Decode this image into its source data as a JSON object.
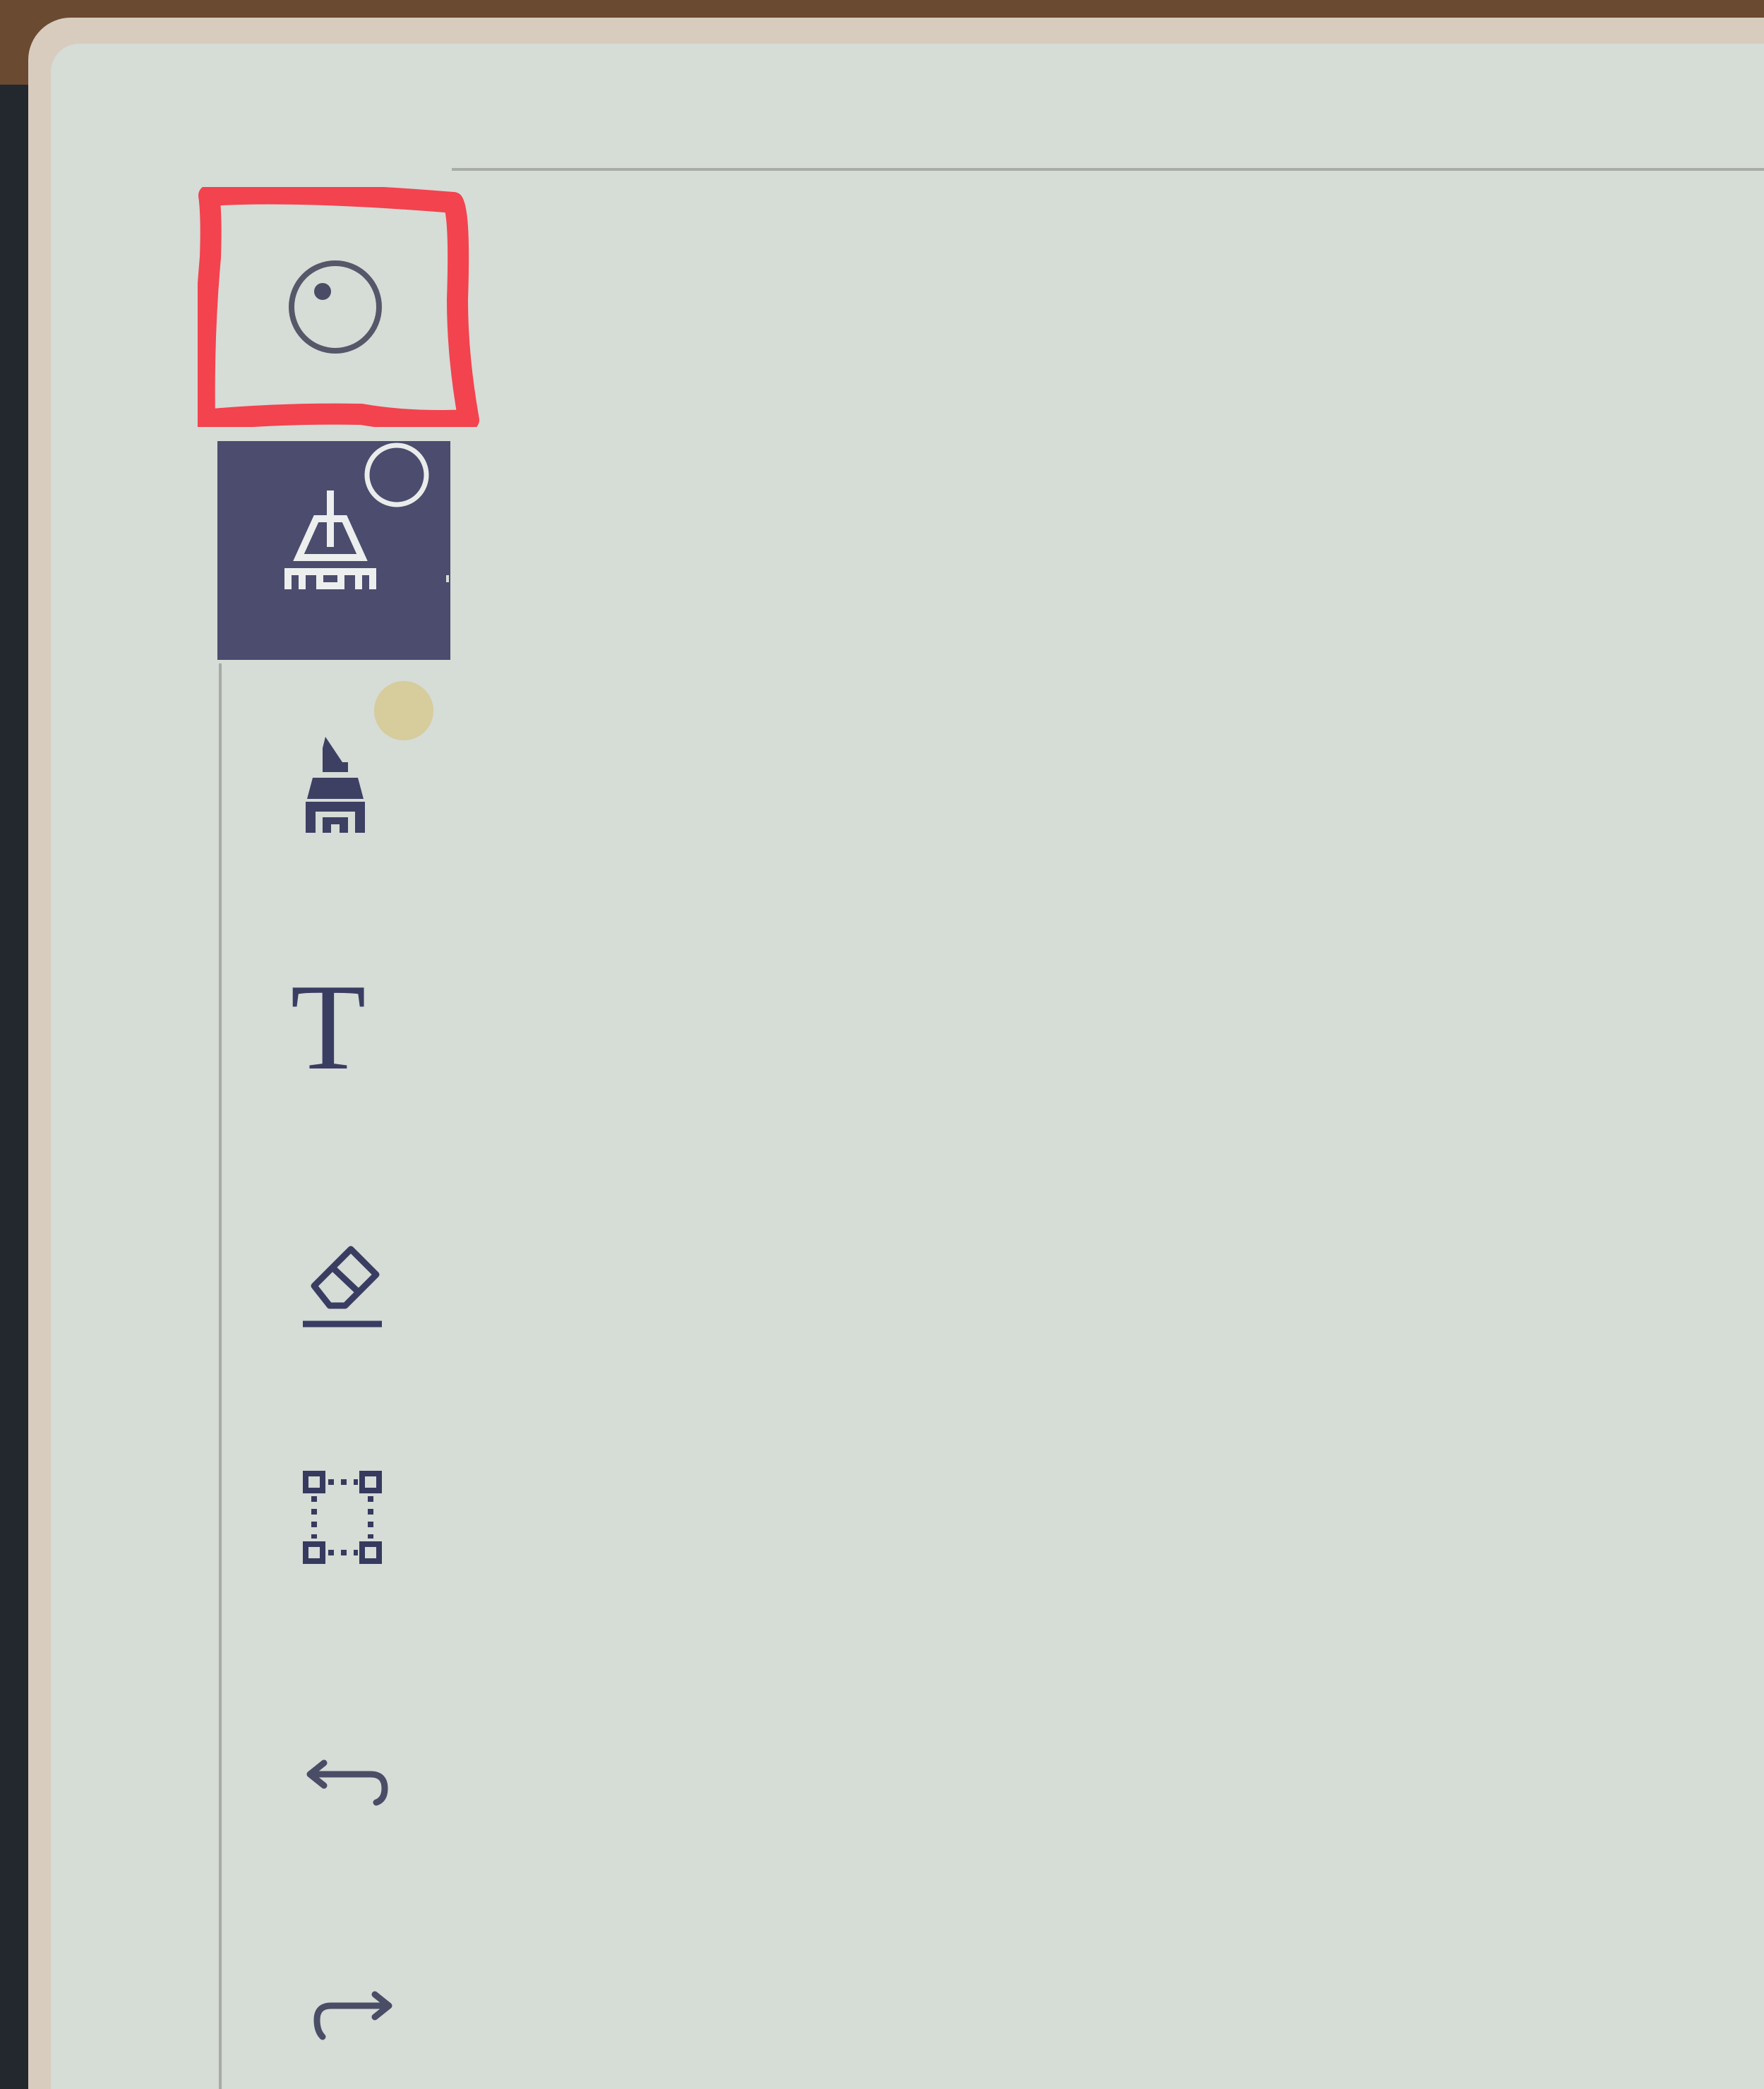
{
  "toolbar": {
    "items": [
      {
        "name": "pointer",
        "icon": "target-dot-icon",
        "active": false,
        "highlighted": true
      },
      {
        "name": "pen",
        "icon": "fineliner-pen-icon",
        "active": true
      },
      {
        "name": "highlighter",
        "icon": "highlighter-icon",
        "active": false
      },
      {
        "name": "text",
        "icon": "text-tool-icon",
        "label": "T",
        "active": false
      },
      {
        "name": "eraser",
        "icon": "eraser-icon",
        "active": false
      },
      {
        "name": "selection",
        "icon": "selection-icon",
        "active": false
      },
      {
        "name": "undo",
        "icon": "undo-icon",
        "active": false
      },
      {
        "name": "redo",
        "icon": "redo-icon",
        "active": false
      }
    ]
  },
  "colors": {
    "screen_bg": "#d6dcd6",
    "active_tool_bg": "#4b4c6e",
    "icon": "#3b3f63",
    "annotation": "#f44b55",
    "highlighter_color_badge": "#d6c992"
  }
}
